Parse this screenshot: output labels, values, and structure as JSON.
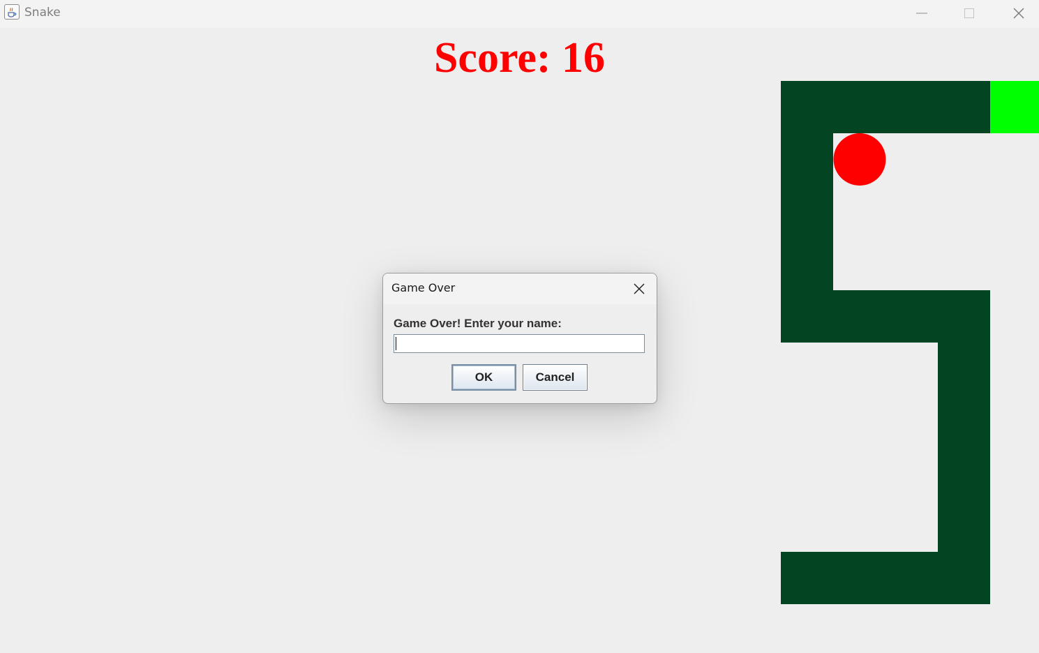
{
  "window": {
    "title": "Snake",
    "icon": "java-cup-icon",
    "controls": [
      "minimize-icon",
      "maximize-icon",
      "close-icon"
    ]
  },
  "game": {
    "score_text": "Score: 16",
    "colors": {
      "score": "#ff0000",
      "snake_body": "#034522",
      "snake_head": "#00ff00",
      "food": "#ff0000",
      "background": "#eeeeee"
    }
  },
  "dialog": {
    "title": "Game Over",
    "message": "Game Over! Enter your name:",
    "input_value": "",
    "ok_label": "OK",
    "cancel_label": "Cancel"
  }
}
